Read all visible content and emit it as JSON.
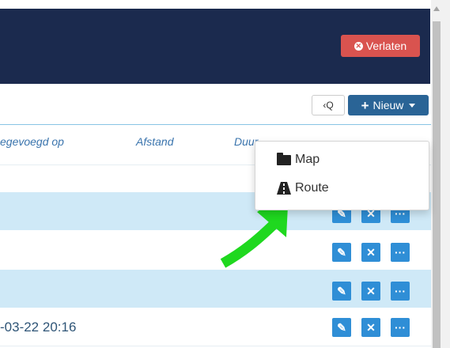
{
  "header": {
    "leave_label": "Verlaten"
  },
  "toolbar": {
    "search_label": "‹Q",
    "new_label": "Nieuw"
  },
  "table": {
    "columns": [
      "egevoegd op",
      "Afstand",
      "Duur"
    ],
    "last_row_date": "-03-22 20:16"
  },
  "dropdown": {
    "items": [
      "Map",
      "Route"
    ]
  },
  "icons": {
    "edit": "pencil-icon",
    "delete": "x-icon",
    "more": "ellipsis-icon"
  },
  "colors": {
    "header": "#1b2a4e",
    "leave": "#d9534f",
    "new": "#2a6496",
    "row_alt": "#cfe9f7",
    "action": "#2f8ed6",
    "annotation_arrow": "#1fd81f"
  }
}
